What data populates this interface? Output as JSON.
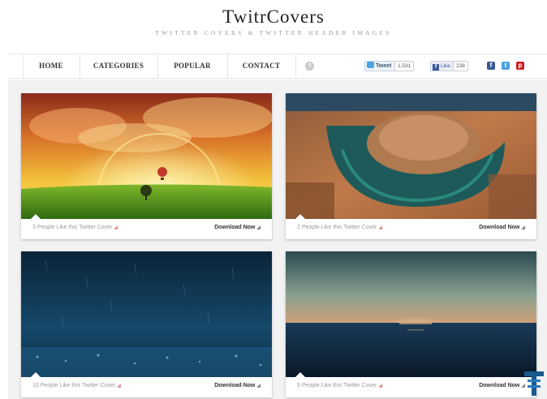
{
  "header": {
    "logo": "TwitrCovers",
    "tagline": "TWITTER COVERS & TWITTER HEADER IMAGES"
  },
  "nav": {
    "items": [
      "HOME",
      "CATEGORIES",
      "POPULAR",
      "CONTACT"
    ],
    "help": "?"
  },
  "social": {
    "tweet_label": "Tweet",
    "tweet_count": "1,531",
    "like_label": "Like",
    "like_count": "238",
    "icons": [
      "facebook-icon",
      "twitter-icon",
      "pinterest-icon"
    ]
  },
  "cards": [
    {
      "likes_text": "3 People Like this Twitter Cover",
      "download_label": "Download Now",
      "image": "sunset-hot-air-balloons-field"
    },
    {
      "likes_text": "2 People Like this Twitter Cover",
      "download_label": "Download Now",
      "image": "horseshoe-bend-canyon"
    },
    {
      "likes_text": "10 People Like this Twitter Cover",
      "download_label": "Download Now",
      "image": "blue-rain-bokeh"
    },
    {
      "likes_text": "9 People Like this Twitter Cover",
      "download_label": "Download Now",
      "image": "ocean-sunset-horizon"
    }
  ],
  "colors": {
    "background": "#ffffff",
    "content_bg": "#f2f2f2",
    "heart": "#e58080",
    "twitter_blue": "#4ba4e0",
    "facebook_blue": "#3b5998",
    "pinterest_red": "#cb2027"
  }
}
